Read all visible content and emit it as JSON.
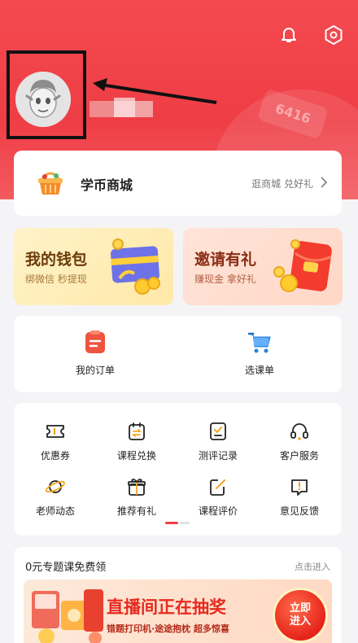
{
  "header": {
    "bell_icon": "bell-icon",
    "settings_icon": "gear-icon",
    "decor_badge": "6416"
  },
  "mall": {
    "title": "学币商城",
    "subtitle": "逛商城 兑好礼",
    "icon": "basket-icon"
  },
  "promos": [
    {
      "title": "我的钱包",
      "subtitle": "绑微信 秒提现",
      "icon": "wallet-card-icon"
    },
    {
      "title": "邀请有礼",
      "subtitle": "赚现金 拿好礼",
      "icon": "red-envelope-icon"
    }
  ],
  "orders": [
    {
      "label": "我的订单",
      "icon": "order-list-icon"
    },
    {
      "label": "选课单",
      "icon": "shopping-cart-icon"
    }
  ],
  "grid": [
    {
      "label": "优惠券",
      "icon": "coupon-icon"
    },
    {
      "label": "课程兑换",
      "icon": "exchange-icon"
    },
    {
      "label": "测评记录",
      "icon": "assessment-icon"
    },
    {
      "label": "客户服务",
      "icon": "headset-icon"
    },
    {
      "label": "老师动态",
      "icon": "planet-icon"
    },
    {
      "label": "推荐有礼",
      "icon": "gift-icon"
    },
    {
      "label": "课程评价",
      "icon": "edit-icon"
    },
    {
      "label": "意见反馈",
      "icon": "feedback-icon"
    }
  ],
  "free_courses": {
    "title": "0元专题课免费领",
    "enter": "点击进入",
    "banner_title": "直播间正在抽奖",
    "banner_sub": "错题打印机·途途抱枕 超多惊喜",
    "banner_button": "立即进入"
  },
  "colors": {
    "brand_red": "#ef3d45",
    "accent_orange": "#e82a1f"
  }
}
